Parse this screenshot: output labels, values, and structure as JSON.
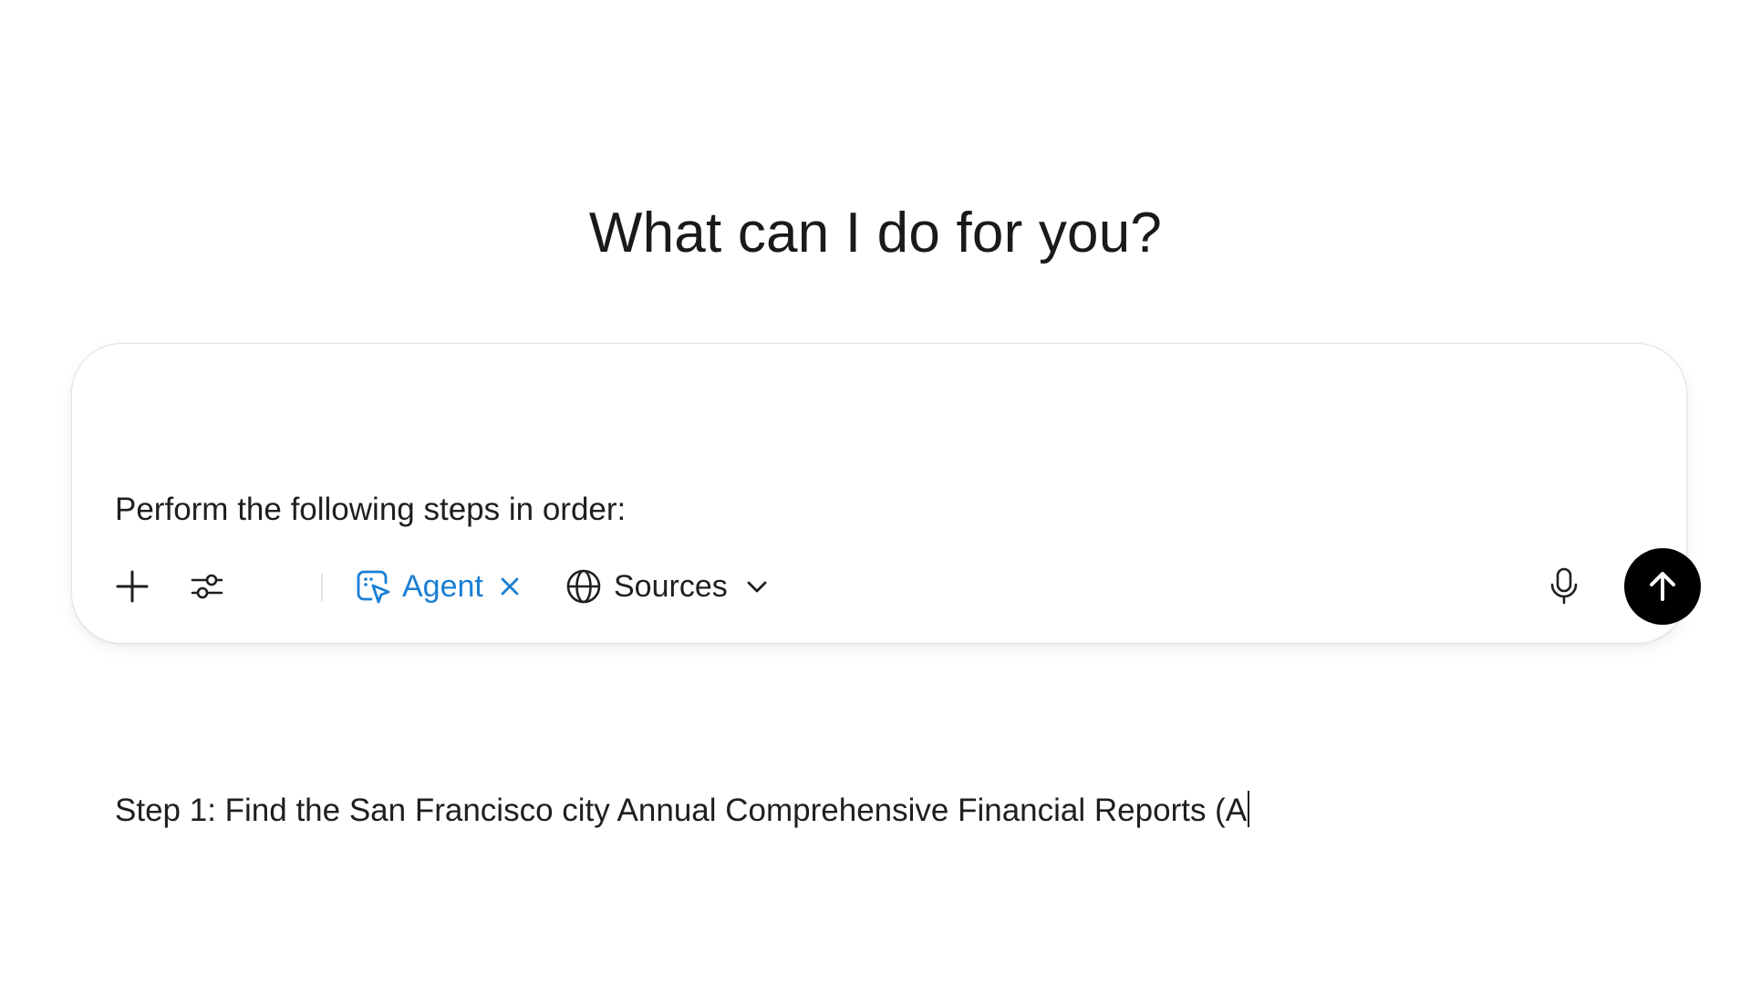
{
  "heading": "What can I do for you?",
  "composer": {
    "lines": [
      "Perform the following steps in order:",
      "",
      "Step 1: Find the San Francisco city Annual Comprehensive Financial Reports (A"
    ]
  },
  "toolbar": {
    "add_icon": "plus-icon",
    "settings_icon": "sliders-icon",
    "agent": {
      "label": "Agent",
      "icon": "agent-cursor-icon",
      "remove_icon": "close-icon",
      "color": "#1a7fd4"
    },
    "sources": {
      "label": "Sources",
      "icon": "globe-icon",
      "chevron": "chevron-down-icon"
    },
    "mic_icon": "microphone-icon",
    "send_icon": "arrow-up-icon"
  }
}
